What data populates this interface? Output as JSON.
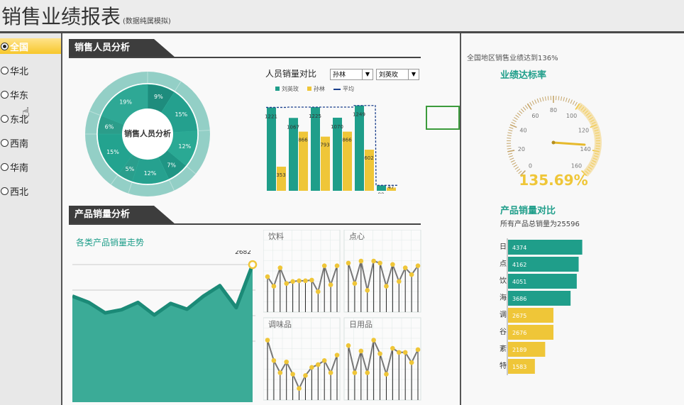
{
  "header": {
    "title": "销售业绩报表",
    "subtitle": "(数据纯属模拟)"
  },
  "regions": [
    {
      "label": "全国",
      "selected": true
    },
    {
      "label": "华北",
      "selected": false
    },
    {
      "label": "华东",
      "selected": false
    },
    {
      "label": "东北",
      "selected": false
    },
    {
      "label": "西南",
      "selected": false
    },
    {
      "label": "华南",
      "selected": false
    },
    {
      "label": "西北",
      "selected": false
    }
  ],
  "sales_section": {
    "title": "销售人员分析"
  },
  "product_section": {
    "title": "产品销量分析"
  },
  "donut": {
    "center_label": "销售人员分析",
    "inner": [
      9,
      15,
      12,
      7,
      12,
      5,
      15,
      6,
      19
    ],
    "inner_labels": [
      "9%",
      "15%",
      "12%",
      "7%",
      "12%",
      "5%",
      "15%",
      "6%",
      "19%"
    ]
  },
  "person_compare": {
    "title": "人员销量对比",
    "select1": "孙林",
    "select2": "刘英玫",
    "legend": [
      "刘英玫",
      "孙林",
      "平均"
    ]
  },
  "colors": {
    "teal": "#1f9e8a",
    "gold": "#efc638",
    "dark": "#3d3d3d",
    "avg": "#1a3f8c"
  },
  "product_trend_title": "各类产品销量走势",
  "product_trend_peak": "2682",
  "small_multiples": [
    {
      "label": "饮料"
    },
    {
      "label": "点心"
    },
    {
      "label": "调味品"
    },
    {
      "label": "日用品"
    }
  ],
  "right": {
    "note": "全国地区销售业绩达到136%",
    "gauge_title": "业绩达标率",
    "gauge_ticks": [
      "0",
      "20",
      "40",
      "60",
      "80",
      "100",
      "120",
      "140",
      "160"
    ],
    "gauge_value_text": "135.69%",
    "gauge_value": 135.69,
    "bars_title": "产品销量对比",
    "bars_subtitle": "所有产品总销量为25596"
  },
  "chart_data": [
    {
      "type": "bar",
      "title": "人员销量对比",
      "categories": [
        "",
        "",
        "",
        "",
        "",
        ""
      ],
      "series": [
        {
          "name": "刘英玫",
          "values": [
            1221,
            1067,
            1225,
            1070,
            1249,
            80
          ],
          "labels": [
            "1221",
            "1067",
            "1225",
            "1070",
            "1249",
            "80"
          ]
        },
        {
          "name": "孙林",
          "values": [
            353,
            866,
            793,
            866,
            602,
            47
          ],
          "labels": [
            "353",
            "866",
            "793",
            "866",
            "602",
            "47"
          ]
        },
        {
          "name": "平均",
          "values": [
            1221,
            1225,
            1225,
            1225,
            1249,
            80
          ]
        }
      ],
      "ylim": [
        0,
        1350
      ]
    },
    {
      "type": "area",
      "title": "各类产品销量走势",
      "values": [
        2080,
        1960,
        1760,
        1820,
        1960,
        1720,
        1940,
        1830,
        2080,
        2280,
        1860,
        2682
      ],
      "ylim": [
        0,
        2900
      ]
    },
    {
      "type": "line",
      "title": "饮料",
      "values": [
        52,
        38,
        65,
        42,
        45,
        46,
        46,
        47,
        30,
        68,
        40,
        68
      ],
      "ylim": [
        0,
        100
      ]
    },
    {
      "type": "line",
      "title": "点心",
      "values": [
        72,
        42,
        75,
        32,
        75,
        72,
        38,
        70,
        45,
        65,
        55,
        68
      ],
      "ylim": [
        0,
        100
      ]
    },
    {
      "type": "line",
      "title": "调味品",
      "values": [
        88,
        58,
        40,
        56,
        38,
        17,
        36,
        48,
        52,
        58,
        40,
        66
      ],
      "ylim": [
        0,
        100
      ]
    },
    {
      "type": "line",
      "title": "日用品",
      "values": [
        80,
        40,
        72,
        40,
        88,
        68,
        38,
        76,
        70,
        70,
        55,
        74
      ],
      "ylim": [
        0,
        100
      ]
    },
    {
      "type": "bar",
      "title": "产品销量对比",
      "categories": [
        "日",
        "点",
        "饮",
        "海",
        "调",
        "谷",
        "紊",
        "特"
      ],
      "values": [
        4374,
        4162,
        4051,
        3686,
        2675,
        2676,
        2189,
        1583
      ],
      "labels": [
        "4374",
        "4162",
        "4051",
        "3686",
        "2675",
        "2676",
        "2189",
        "1583"
      ],
      "colors": [
        "#1f9e8a",
        "#1f9e8a",
        "#1f9e8a",
        "#1f9e8a",
        "#efc638",
        "#efc638",
        "#efc638",
        "#efc638"
      ]
    }
  ]
}
